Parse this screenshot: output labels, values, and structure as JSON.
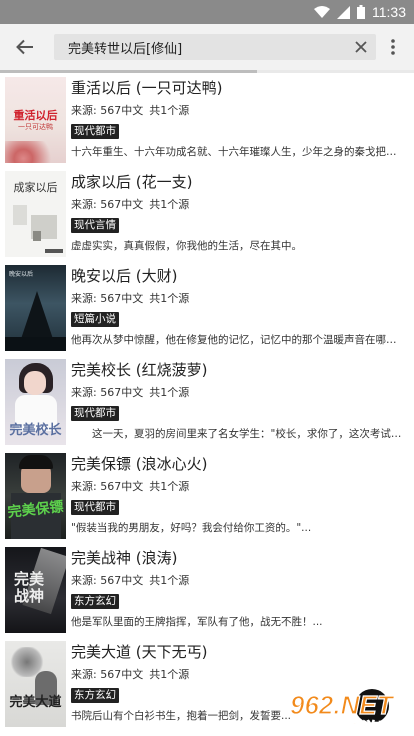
{
  "status": {
    "time": "11:33"
  },
  "search": {
    "query": "完美转世以后[修仙]"
  },
  "books": [
    {
      "title": "重活以后 (一只可达鸭)",
      "source": "来源: 567中文",
      "count": "共1个源",
      "tag": "现代都市",
      "desc": "十六年重生、十六年功成名就、十六年璀璨人生，少年之身的秦戈把该...",
      "cover_text": "重活以后",
      "cover_sub": "一只可达鸭"
    },
    {
      "title": "成家以后 (花一支)",
      "source": "来源: 567中文",
      "count": "共1个源",
      "tag": "现代言情",
      "desc": "虚虚实实，真真假假，你我他的生活，尽在其中。",
      "cover_text": "成家以后",
      "cover_sub": ""
    },
    {
      "title": "晚安以后 (大财)",
      "source": "来源: 567中文",
      "count": "共1个源",
      "tag": "短篇小说",
      "desc": "他再次从梦中惊醒，他在修复他的记忆，记忆中的那个温暖声音在哪里...",
      "cover_text": "晚安以后",
      "cover_sub": ""
    },
    {
      "title": "完美校长 (红烧菠萝)",
      "source": "来源: 567中文",
      "count": "共1个源",
      "tag": "现代都市",
      "desc": "　　这一天，夏羽的房间里来了名女学生：\"校长，求你了，这次考试让...",
      "cover_text": "完美校长",
      "cover_sub": ""
    },
    {
      "title": "完美保镖 (浪冰心火)",
      "source": "来源: 567中文",
      "count": "共1个源",
      "tag": "现代都市",
      "desc": "\"假装当我的男朋友，好吗？我会付给你工资的。\"...",
      "cover_text": "完美保镖",
      "cover_sub": ""
    },
    {
      "title": "完美战神 (浪涛)",
      "source": "来源: 567中文",
      "count": "共1个源",
      "tag": "东方玄幻",
      "desc": "他是军队里面的王牌指挥，军队有了他，战无不胜！...",
      "cover_text": "完美战神",
      "cover_sub": ""
    },
    {
      "title": "完美大道 (天下无丐)",
      "source": "来源: 567中文",
      "count": "共1个源",
      "tag": "东方玄幻",
      "desc": "书院后山有个白衫书生，抱着一把剑，发誓要...",
      "cover_text": "完美大道",
      "cover_sub": ""
    }
  ],
  "watermark": {
    "brand": "962.NET",
    "sub": "乐游网"
  },
  "load_progress": 0.62
}
